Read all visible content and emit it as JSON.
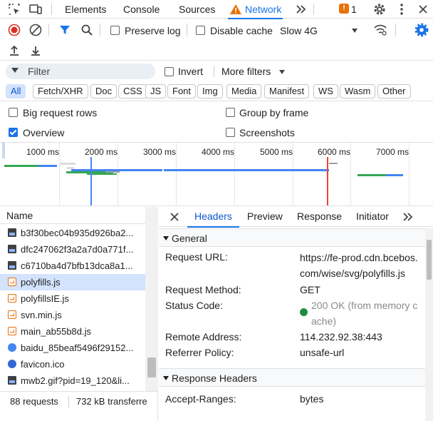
{
  "tabs": {
    "elements": "Elements",
    "console": "Console",
    "sources": "Sources",
    "network": "Network",
    "issues_count": "1"
  },
  "toolbar": {
    "preserve_log": "Preserve log",
    "disable_cache": "Disable cache",
    "throttling": "Slow 4G"
  },
  "filter": {
    "placeholder": "Filter",
    "invert": "Invert",
    "more_filters": "More filters"
  },
  "type_chips": [
    "All",
    "Fetch/XHR",
    "Doc",
    "CSS",
    "JS",
    "Font",
    "Img",
    "Media",
    "Manifest",
    "WS",
    "Wasm",
    "Other"
  ],
  "options": {
    "big_rows": "Big request rows",
    "group_by_frame": "Group by frame",
    "overview": "Overview",
    "screenshots": "Screenshots"
  },
  "timeline": {
    "ticks": [
      "1000 ms",
      "2000 ms",
      "3000 ms",
      "4000 ms",
      "5000 ms",
      "6000 ms",
      "7000 ms"
    ]
  },
  "request_list": {
    "header": "Name",
    "items": [
      {
        "name": "b3f30bec04b935d926ba2...",
        "type": "img"
      },
      {
        "name": "dfc247062f3a2a7d0a771f...",
        "type": "img"
      },
      {
        "name": "c6710ba4d7bfb13dca8a1...",
        "type": "img"
      },
      {
        "name": "polyfills.js",
        "type": "script",
        "selected": true
      },
      {
        "name": "polyfillsIE.js",
        "type": "script"
      },
      {
        "name": "svn.min.js",
        "type": "script"
      },
      {
        "name": "main_ab55b8d.js",
        "type": "script"
      },
      {
        "name": "baidu_85beaf5496f29152...",
        "type": "other"
      },
      {
        "name": "favicon.ico",
        "type": "other"
      },
      {
        "name": "mwb2.gif?pid=19_120&li...",
        "type": "img"
      }
    ],
    "status_requests": "88 requests",
    "status_transferred": "732 kB transferre"
  },
  "detail": {
    "tabs": [
      "Headers",
      "Preview",
      "Response",
      "Initiator"
    ],
    "general_title": "General",
    "general": {
      "request_url_label": "Request URL:",
      "request_url_line1": "https://fe-prod.cdn.bcebos.",
      "request_url_line2": "com/wise/svg/polyfills.js",
      "request_method_label": "Request Method:",
      "request_method": "GET",
      "status_code_label": "Status Code:",
      "status_code_line1": "200 OK (from memory c",
      "status_code_line2": "ache)",
      "remote_address_label": "Remote Address:",
      "remote_address": "114.232.92.38:443",
      "referrer_policy_label": "Referrer Policy:",
      "referrer_policy": "unsafe-url"
    },
    "response_headers_title": "Response Headers",
    "response_headers": {
      "accept_ranges_label": "Accept-Ranges:",
      "accept_ranges": "bytes"
    }
  },
  "colors": {
    "accent": "#1a73e8",
    "selected_row": "#d3e3fd",
    "warning": "#e8710a",
    "record_red": "#d93025",
    "status_green": "#1e8e3e"
  }
}
